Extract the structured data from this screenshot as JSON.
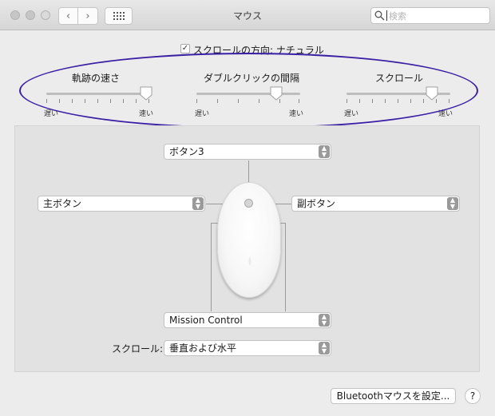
{
  "window": {
    "title": "マウス"
  },
  "toolbar": {
    "back_glyph": "‹",
    "forward_glyph": "›",
    "search_placeholder": "検索"
  },
  "options": {
    "scroll_direction_label": "スクロールの方向: ナチュラル",
    "scroll_direction_checked": true,
    "check_glyph": "✓"
  },
  "sliders": [
    {
      "label": "軌跡の速さ",
      "min_label": "遅い",
      "max_label": "速い",
      "value": 1.0
    },
    {
      "label": "ダブルクリックの間隔",
      "min_label": "遅い",
      "max_label": "速い",
      "value": 0.8
    },
    {
      "label": "スクロール",
      "min_label": "遅い",
      "max_label": "速い",
      "value": 0.85
    }
  ],
  "buttons_config": {
    "top": {
      "value": "ボタン3"
    },
    "left": {
      "value": "主ボタン"
    },
    "right": {
      "value": "副ボタン"
    },
    "side": {
      "value": "Mission Control"
    },
    "scroll_label": "スクロール:",
    "scroll": {
      "value": "垂直および水平"
    }
  },
  "footer": {
    "bluetooth_button": "Bluetoothマウスを設定...",
    "help_label": "?"
  },
  "colors": {
    "annotation_oval": "#3a1fa5",
    "popup_arrow": "#9a9a9a"
  }
}
